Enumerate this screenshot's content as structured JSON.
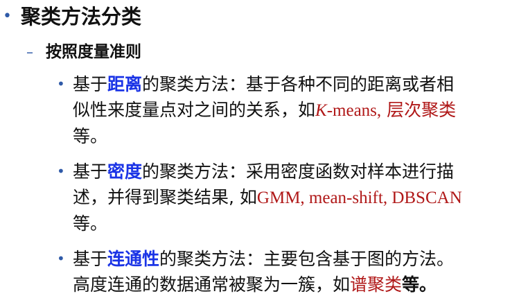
{
  "section": {
    "title": "聚类方法分类",
    "subtitle": "按照度量准则"
  },
  "items": [
    {
      "prefix": "基于",
      "keyword": "距离",
      "rest_line1": "的聚类方法：基于各种不同的距离或者相",
      "line2_pre": "似性来度量点对之间的关系，如",
      "example_italic": "K",
      "example_latin": "-means,",
      "example_cn": "层次聚类",
      "tail": "等。"
    },
    {
      "prefix": "基于",
      "keyword": "密度",
      "rest_line1": "的聚类方法：采用密度函数对样本进行描",
      "line2_pre": "述，并得到聚类结果, 如",
      "example_latin": "GMM, mean-shift, DBSCAN",
      "tail": "等。"
    },
    {
      "prefix": "基于",
      "keyword": "连通性",
      "rest_line1": "的聚类方法：主要包含基于图的方法。",
      "line2_pre": "高度连通的数据通常被聚为一簇，如",
      "example_cn": "谱聚类",
      "tail": "等。"
    }
  ],
  "colors": {
    "bullet": "#2f5aa8",
    "keyword": "#1a33e6",
    "example": "#b01818"
  }
}
